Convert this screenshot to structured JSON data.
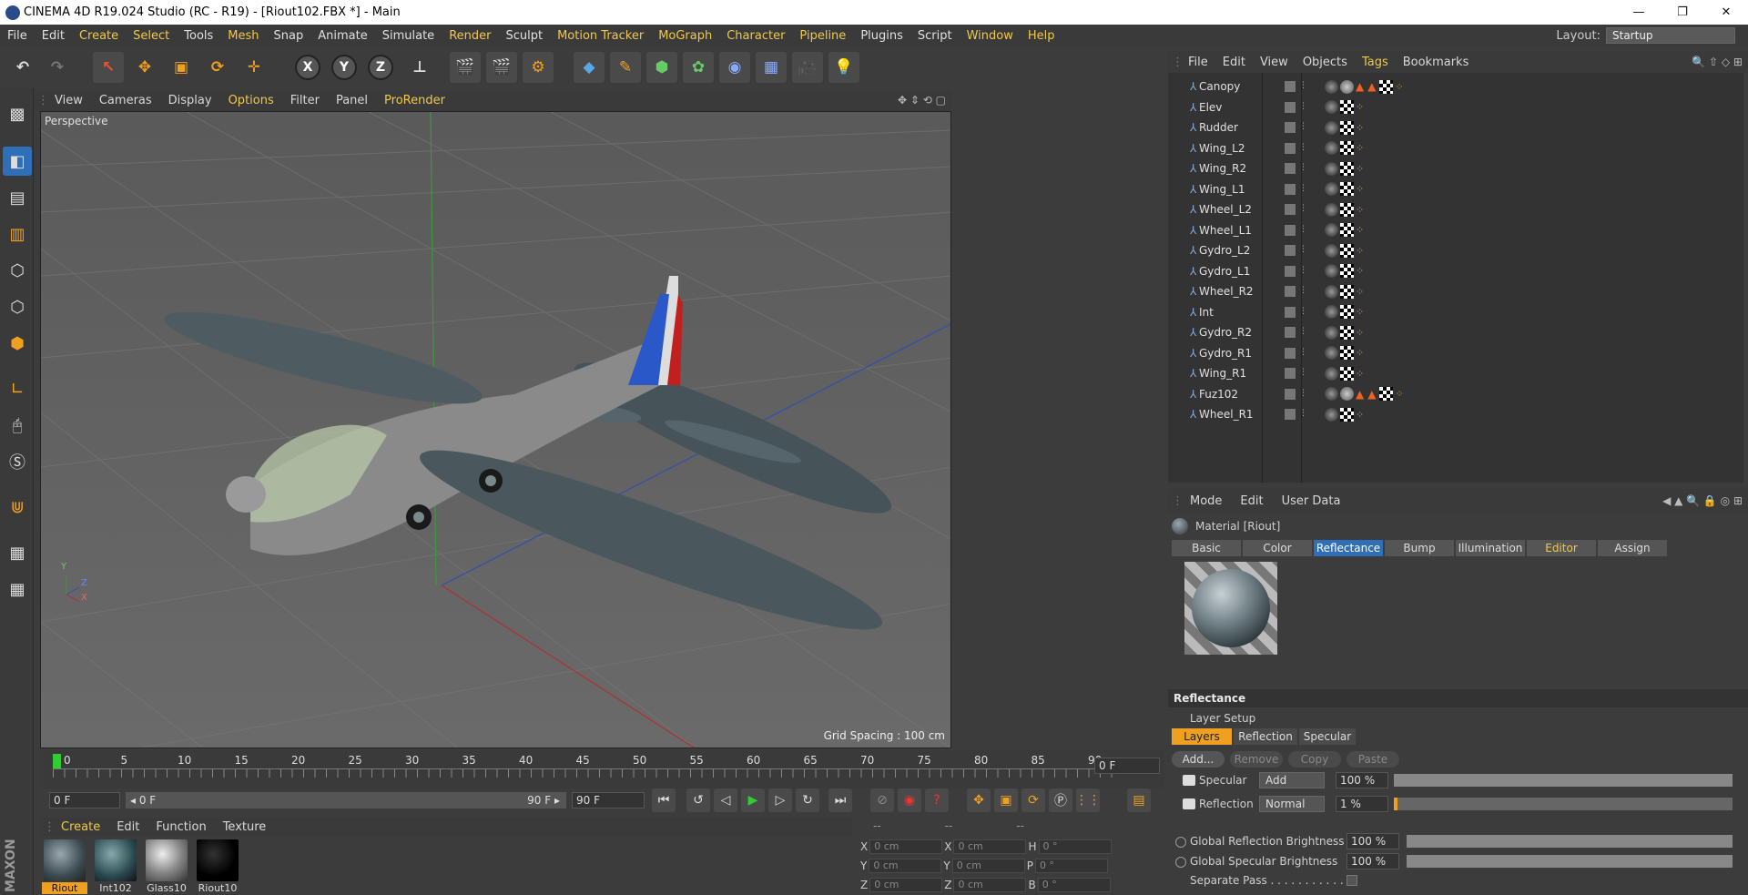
{
  "window": {
    "title": "CINEMA 4D R19.024 Studio (RC - R19) - [Riout102.FBX *] - Main",
    "minimize": "—",
    "restore": "❐",
    "close": "✕"
  },
  "menubar": {
    "items": [
      "File",
      "Edit",
      "Create",
      "Select",
      "Tools",
      "Mesh",
      "Snap",
      "Animate",
      "Simulate",
      "Render",
      "Sculpt",
      "Motion Tracker",
      "MoGraph",
      "Character",
      "Pipeline",
      "Plugins",
      "Script",
      "Window",
      "Help"
    ],
    "layout_label": "Layout:",
    "layout_value": "Startup"
  },
  "viewport": {
    "menu": [
      "View",
      "Cameras",
      "Display",
      "Options",
      "Filter",
      "Panel",
      "ProRender"
    ],
    "label": "Perspective",
    "grid_spacing": "Grid Spacing : 100 cm",
    "axis_y": "Y",
    "axis_z": "Z",
    "axis_x": "X"
  },
  "timeline": {
    "ticks": [
      "0",
      "5",
      "10",
      "15",
      "20",
      "25",
      "30",
      "35",
      "40",
      "45",
      "50",
      "55",
      "60",
      "65",
      "70",
      "75",
      "80",
      "85",
      "90"
    ],
    "current_frame": "0 F",
    "start_field": "0 F",
    "range_start": "◂ 0 F",
    "range_end": "90 F ▸",
    "end_field": "90 F"
  },
  "material_manager": {
    "menu": [
      "Create",
      "Edit",
      "Function",
      "Texture"
    ],
    "materials": [
      "Riout",
      "Int102",
      "Glass10",
      "Riout10"
    ]
  },
  "coordinates": {
    "headers": [
      "--",
      "--",
      "--"
    ],
    "rows": [
      {
        "a": "X",
        "av": "0 cm",
        "b": "X",
        "bv": "0 cm",
        "c": "H",
        "cv": "0 °"
      },
      {
        "a": "Y",
        "av": "0 cm",
        "b": "Y",
        "bv": "0 cm",
        "c": "P",
        "cv": "0 °"
      },
      {
        "a": "Z",
        "av": "0 cm",
        "b": "Z",
        "bv": "0 cm",
        "c": "B",
        "cv": "0 °"
      }
    ]
  },
  "object_manager": {
    "menu": [
      "File",
      "Edit",
      "View",
      "Objects",
      "Tags",
      "Bookmarks"
    ],
    "objects": [
      {
        "name": "Canopy",
        "tags": "tri"
      },
      {
        "name": "Elev",
        "tags": "std"
      },
      {
        "name": "Rudder",
        "tags": "std"
      },
      {
        "name": "Wing_L2",
        "tags": "std"
      },
      {
        "name": "Wing_R2",
        "tags": "std"
      },
      {
        "name": "Wing_L1",
        "tags": "std"
      },
      {
        "name": "Wheel_L2",
        "tags": "std"
      },
      {
        "name": "Wheel_L1",
        "tags": "std"
      },
      {
        "name": "Gydro_L2",
        "tags": "std"
      },
      {
        "name": "Gydro_L1",
        "tags": "std"
      },
      {
        "name": "Wheel_R2",
        "tags": "std"
      },
      {
        "name": "Int",
        "tags": "std"
      },
      {
        "name": "Gydro_R2",
        "tags": "std"
      },
      {
        "name": "Gydro_R1",
        "tags": "std"
      },
      {
        "name": "Wing_R1",
        "tags": "std"
      },
      {
        "name": "Fuz102",
        "tags": "tri"
      },
      {
        "name": "Wheel_R1",
        "tags": "std"
      }
    ]
  },
  "attributes": {
    "menu": [
      "Mode",
      "Edit",
      "User Data"
    ],
    "material_title": "Material [Riout]",
    "tabs": [
      "Basic",
      "Color",
      "Reflectance",
      "Bump",
      "Illumination",
      "Editor",
      "Assign"
    ],
    "section": "Reflectance",
    "layer_setup": "Layer Setup",
    "layer_tabs": [
      "Layers",
      "Reflection",
      "Specular"
    ],
    "layer_buttons": [
      "Add...",
      "Remove",
      "Copy",
      "Paste"
    ],
    "layers": [
      {
        "name": "Specular",
        "mode": "Add",
        "value": "100 %",
        "level": 1.0
      },
      {
        "name": "Reflection",
        "mode": "Normal",
        "value": "1 %",
        "level": 0.01
      }
    ],
    "global": [
      {
        "label": "Global Reflection Brightness",
        "value": "100 %",
        "level": 1.0
      },
      {
        "label": "Global Specular Brightness",
        "value": "100 %",
        "level": 1.0
      }
    ],
    "separate_pass": "Separate Pass . . . . . . . . . . . ."
  },
  "colors": {
    "accent": "#f0c84a",
    "selected_blue": "#2f6fb8",
    "orange": "#f0a020"
  }
}
